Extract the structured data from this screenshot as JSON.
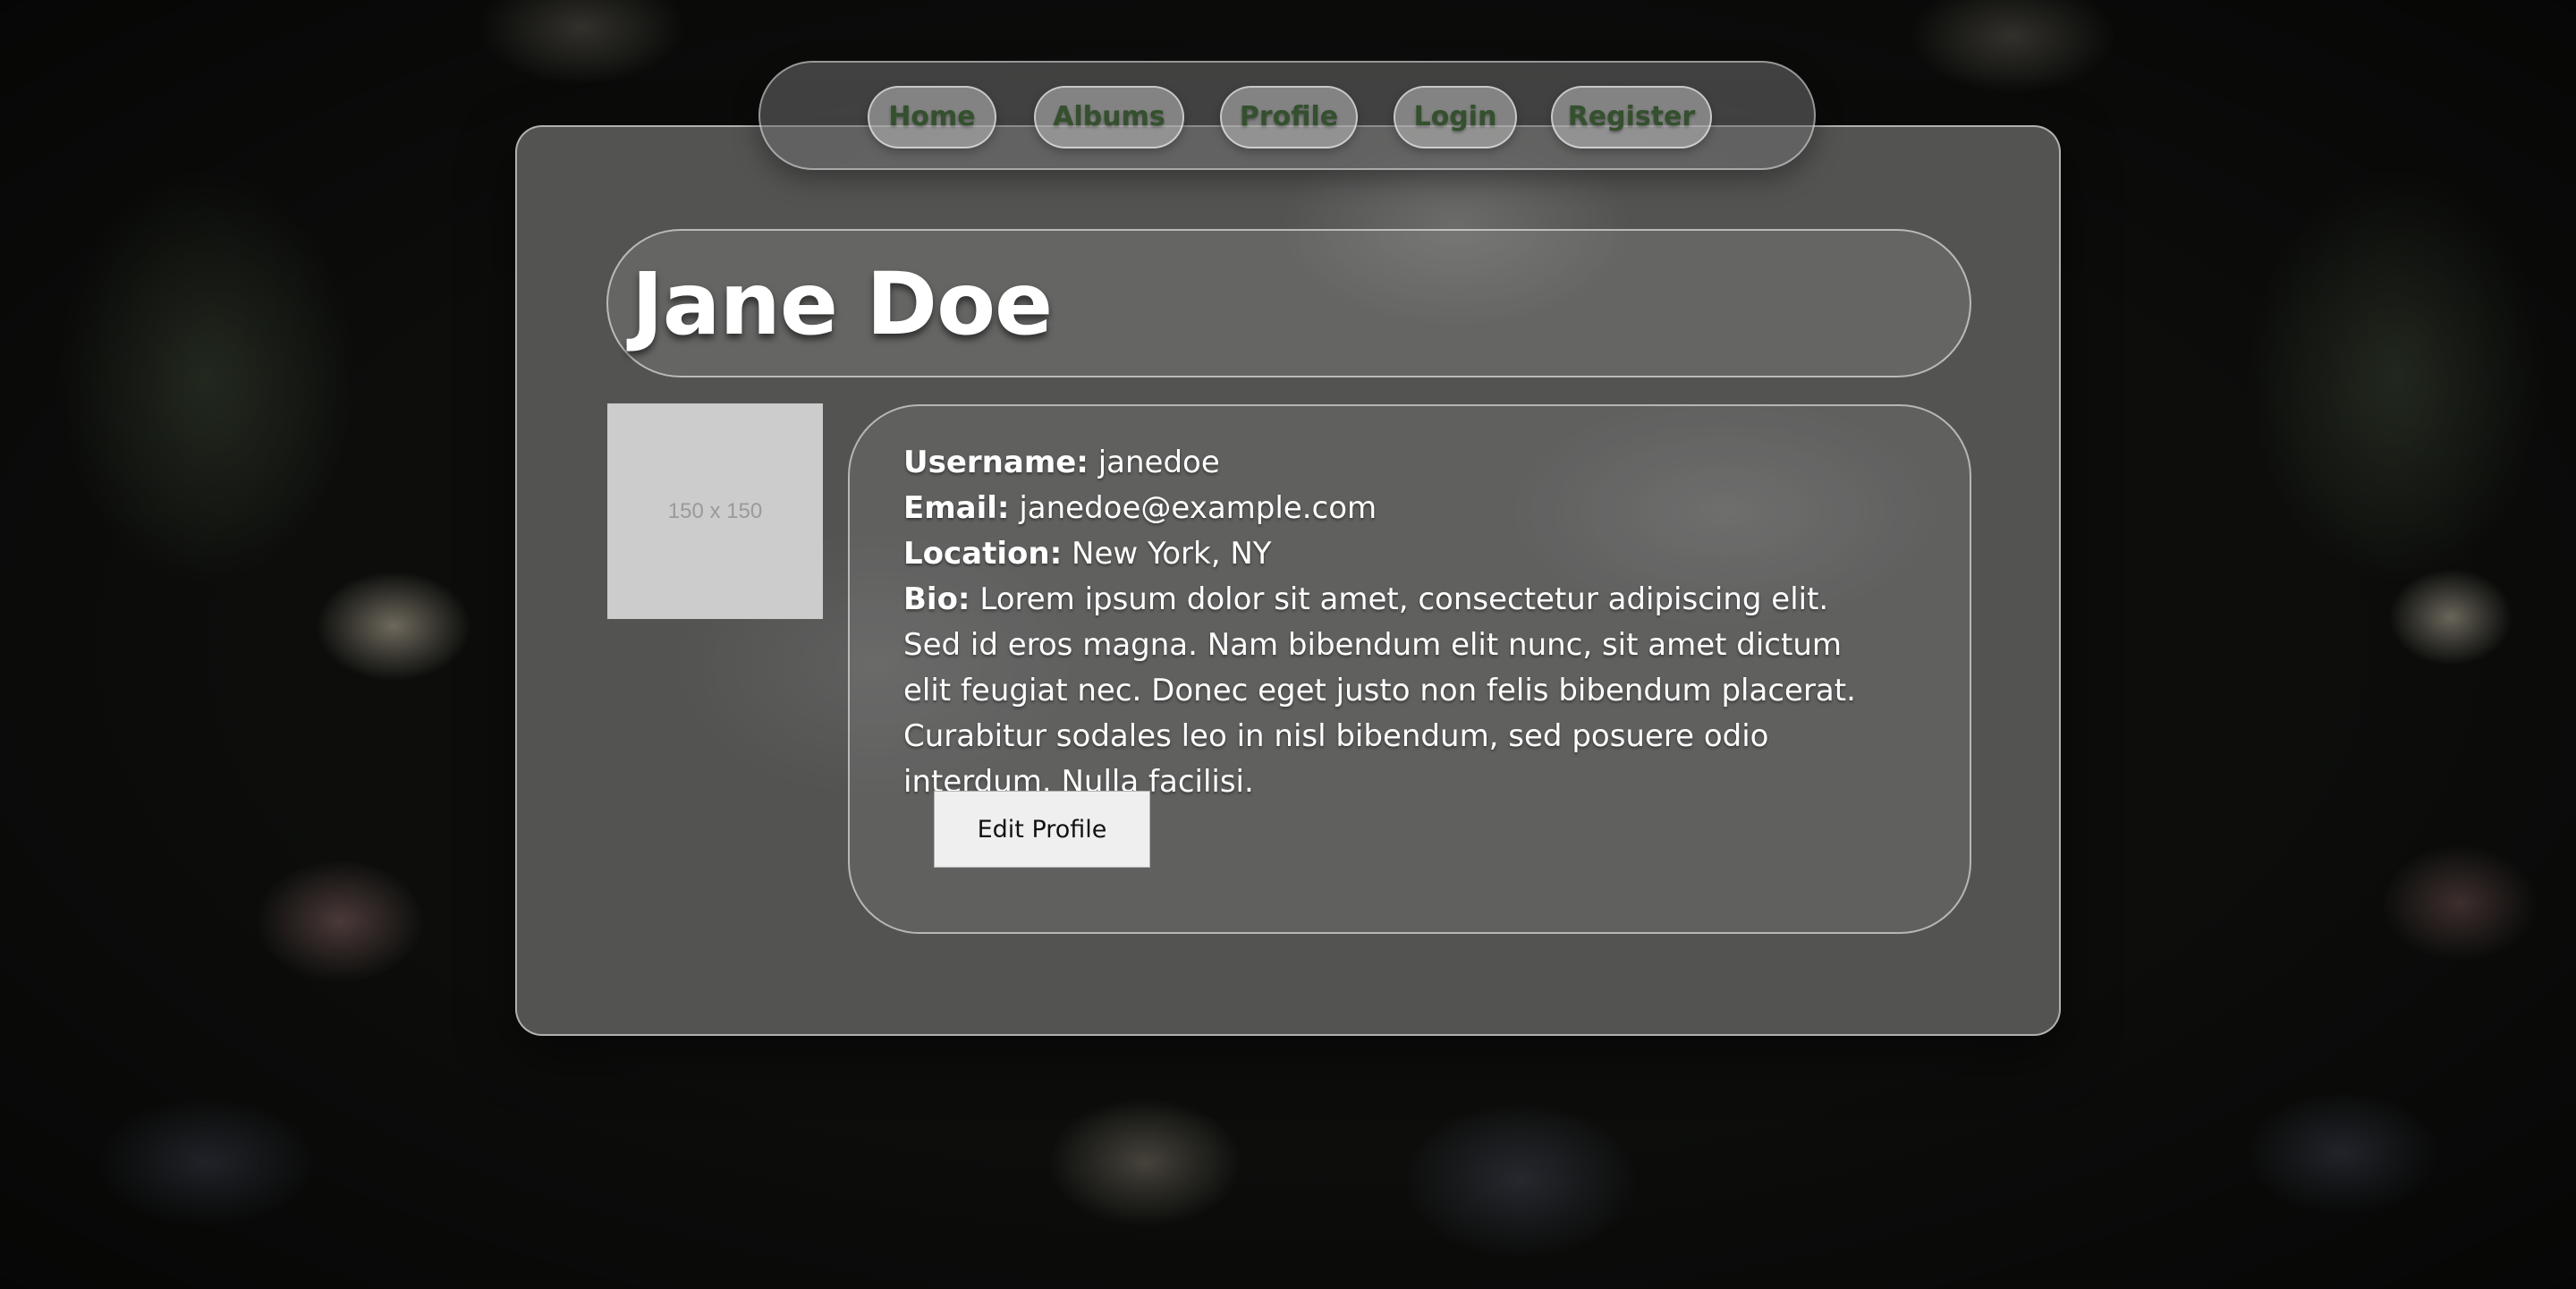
{
  "nav": {
    "items": [
      {
        "label": "Home"
      },
      {
        "label": "Albums"
      },
      {
        "label": "Profile"
      },
      {
        "label": "Login"
      },
      {
        "label": "Register"
      }
    ]
  },
  "profile": {
    "name": "Jane Doe",
    "avatar_placeholder": "150 x 150",
    "username_label": "Username:",
    "username": "janedoe",
    "email_label": "Email:",
    "email": "janedoe@example.com",
    "location_label": "Location:",
    "location": "New York, NY",
    "bio_label": "Bio:",
    "bio": "Lorem ipsum dolor sit amet, consectetur adipiscing elit. Sed id eros magna. Nam bibendum elit nunc, sit amet dictum elit feugiat nec. Donec eget justo non felis bibendum placerat. Curabitur sodales leo in nisl bibendum, sed posuere odio interdum. Nulla facilisi.",
    "edit_button_label": "Edit Profile"
  },
  "colors": {
    "nav_text": "#34502e",
    "card_background": "#60605e",
    "button_background": "#efefef"
  }
}
